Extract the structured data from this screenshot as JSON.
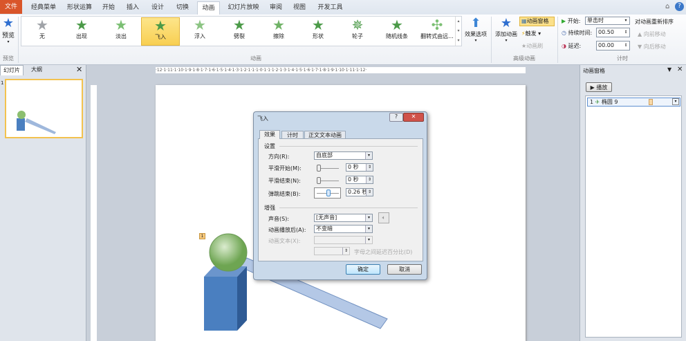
{
  "tabs": {
    "file": "文件",
    "items": [
      "经典菜单",
      "形状运算",
      "开始",
      "插入",
      "设计",
      "切换",
      "动画",
      "幻灯片放映",
      "审阅",
      "视图",
      "开发工具"
    ],
    "active": "动画"
  },
  "ribbon": {
    "preview": {
      "label": "预览",
      "group": "预览"
    },
    "gallery": [
      "无",
      "出现",
      "淡出",
      "飞入",
      "浮入",
      "劈裂",
      "擦除",
      "形状",
      "轮子",
      "随机线条",
      "翻转式由远..."
    ],
    "gallery_selected": "飞入",
    "effect_options": "效果选项",
    "animation_group": "动画",
    "add_animation": "添加动画",
    "animation_pane": "动画窗格",
    "trigger": "触发",
    "animation_painter": "动画刷",
    "advanced_group": "高级动画",
    "start_label": "开始:",
    "start_value": "单击时",
    "duration_label": "持续时间:",
    "duration_value": "00.50",
    "delay_label": "延迟:",
    "delay_value": "00.00",
    "reorder": "对动画重新排序",
    "move_earlier": "向前移动",
    "move_later": "向后移动",
    "timing_group": "计时"
  },
  "left_panel": {
    "tab_slides": "幻灯片",
    "tab_outline": "大纲",
    "slide_number": "1"
  },
  "ruler": "·12·1·11·1·10·1·9·1·8·1·7·1·6·1·5·1·4·1·3·1·2·1·1·1·0·1·1·1·2·1·3·1·4·1·5·1·6·1·7·1·8·1·9·1·10·1·11·1·12·",
  "slide": {
    "anim_tag": "1"
  },
  "pane": {
    "title": "动画窗格",
    "play": "播放",
    "item_num": "1",
    "item_name": "椭圆 9"
  },
  "dialog": {
    "title": "飞入",
    "tabs": [
      "效果",
      "计时",
      "正文文本动画"
    ],
    "settings": "设置",
    "direction_label": "方向(R):",
    "direction_value": "自底部",
    "smooth_start_label": "平滑开始(M):",
    "smooth_start_value": "0 秒",
    "smooth_end_label": "平滑结束(N):",
    "smooth_end_value": "0 秒",
    "bounce_end_label": "弹跳结束(B):",
    "bounce_end_value": "0.26 秒",
    "enhance": "增强",
    "sound_label": "声音(S):",
    "sound_value": "[无声音]",
    "after_label": "动画播放后(A):",
    "after_value": "不变暗",
    "text_label": "动画文本(X):",
    "letter_delay": "字母之间延迟百分比(D)",
    "ok": "确定",
    "cancel": "取消"
  }
}
